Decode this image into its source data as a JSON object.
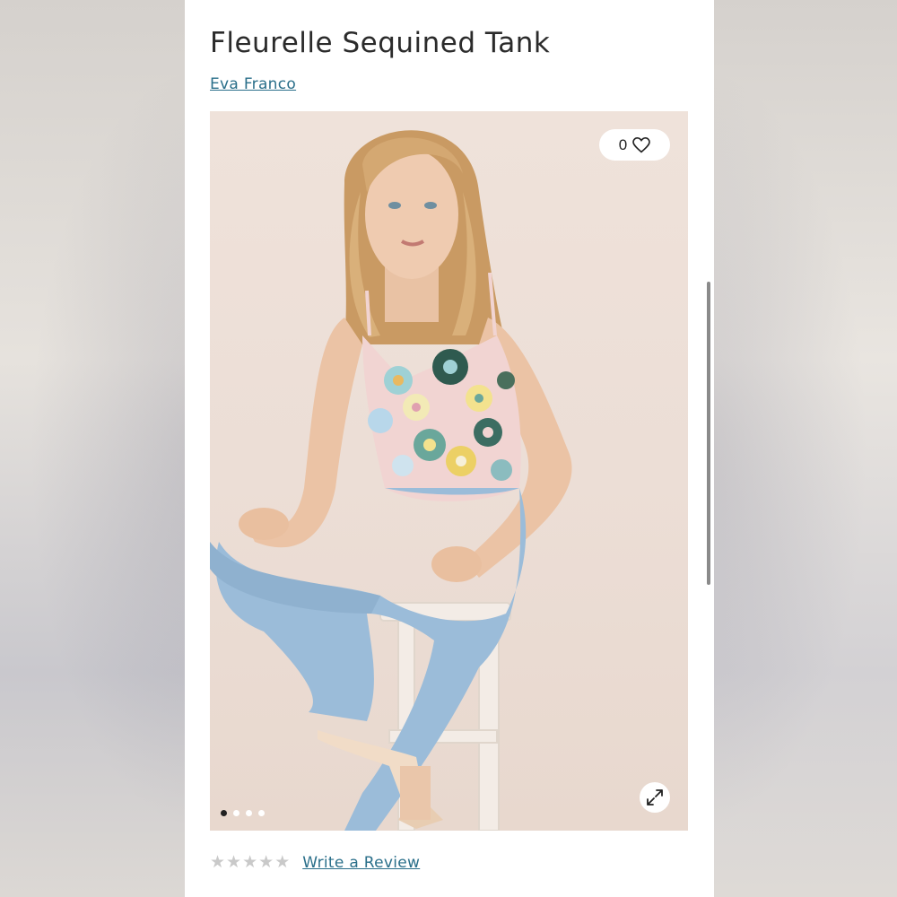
{
  "product": {
    "title": "Fleurelle Sequined Tank",
    "brand": "Eva Franco"
  },
  "gallery": {
    "favorite_count": "0",
    "total_slides": 4,
    "active_slide": 1
  },
  "reviews": {
    "rating": 0,
    "max_rating": 5,
    "write_review_label": "Write a Review"
  },
  "colors": {
    "link": "#2a6f8a",
    "title": "#2b2b2b"
  }
}
